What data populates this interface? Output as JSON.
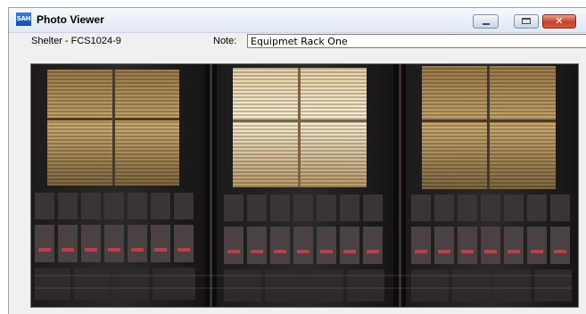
{
  "window": {
    "title": "Photo Viewer",
    "app_icon_text": "SAH",
    "buttons": {
      "minimize_icon": "minimize-icon",
      "maximize_icon": "maximize-icon",
      "close_icon": "close-icon",
      "close_glyph": "✕"
    }
  },
  "header": {
    "shelter_label": "Shelter - FCS1024-9",
    "note_label": "Note:",
    "note_value": "Equipmet Rack One"
  },
  "photo": {
    "subject": "equipment-rack-photo"
  }
}
